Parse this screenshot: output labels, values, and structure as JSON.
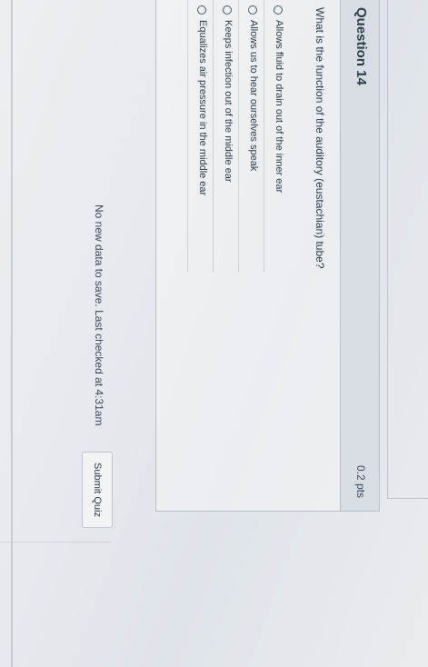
{
  "question": {
    "title": "Question 14",
    "points": "0.2 pts",
    "text": "What is the function of the auditory (eustachian) tube?",
    "answers": [
      "Allows fluid to drain out of the inner ear",
      "Allows us to hear ourselves speak",
      "Keeps infection out of the middle ear",
      "Equalizes air pressure in the middle ear"
    ]
  },
  "footer": {
    "status": "No new data to save. Last checked at 4:31am",
    "submit_label": "Submit Quiz"
  }
}
